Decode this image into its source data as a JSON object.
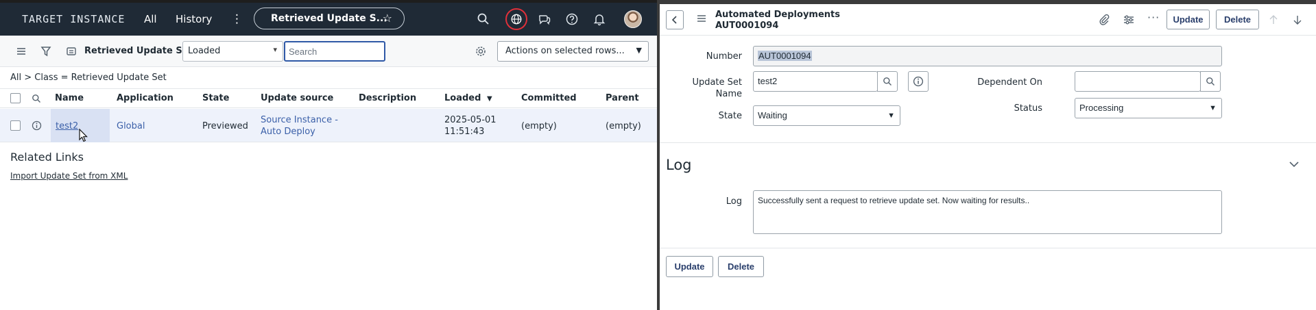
{
  "left_window": {
    "nav": {
      "instance_label": "TARGET INSTANCE",
      "all": "All",
      "history": "History",
      "active_tab": "Retrieved Update S...",
      "icons": [
        "search-icon",
        "globe-icon",
        "chat-icon",
        "help-icon",
        "bell-icon"
      ]
    },
    "toolbar": {
      "title": "Retrieved Update Sets",
      "filter_field": "Loaded",
      "search_placeholder": "Search",
      "actions_label": "Actions on selected rows..."
    },
    "breadcrumb": "All > Class = Retrieved Update Set",
    "table": {
      "columns": [
        "Name",
        "Application",
        "State",
        "Update source",
        "Description",
        "Loaded",
        "Committed",
        "Parent"
      ],
      "sort_indicator": "▼",
      "rows": [
        {
          "name": "test2",
          "application": "Global",
          "state": "Previewed",
          "update_source_line1": "Source Instance -",
          "update_source_line2": "Auto Deploy",
          "description": "",
          "loaded_line1": "2025-05-01",
          "loaded_line2": "11:51:43",
          "committed": "(empty)",
          "parent": "(empty)"
        }
      ]
    },
    "related_links": {
      "title": "Related Links",
      "items": [
        "Import Update Set from XML"
      ]
    }
  },
  "right_window": {
    "header": {
      "title": "Automated Deployments",
      "record": "AUT0001094",
      "update_label": "Update",
      "delete_label": "Delete"
    },
    "form": {
      "number_label": "Number",
      "number_value": "AUT0001094",
      "update_set_label_line1": "Update Set",
      "update_set_label_line2": "Name",
      "update_set_value": "test2",
      "dependent_on_label": "Dependent On",
      "dependent_on_value": "",
      "state_label": "State",
      "state_value": "Waiting",
      "status_label": "Status",
      "status_value": "Processing"
    },
    "log": {
      "section_title": "Log",
      "field_label": "Log",
      "value": "Successfully sent a request to retrieve update set. Now waiting for results.."
    },
    "footer": {
      "update_label": "Update",
      "delete_label": "Delete"
    }
  },
  "colors": {
    "navbar_bg": "#1f2a36",
    "link": "#3a5fa8",
    "button_text": "#293e6b",
    "selected_row": "#eef2fb",
    "search_focus": "#2e58a6",
    "globe_ring": "#e0303a"
  }
}
